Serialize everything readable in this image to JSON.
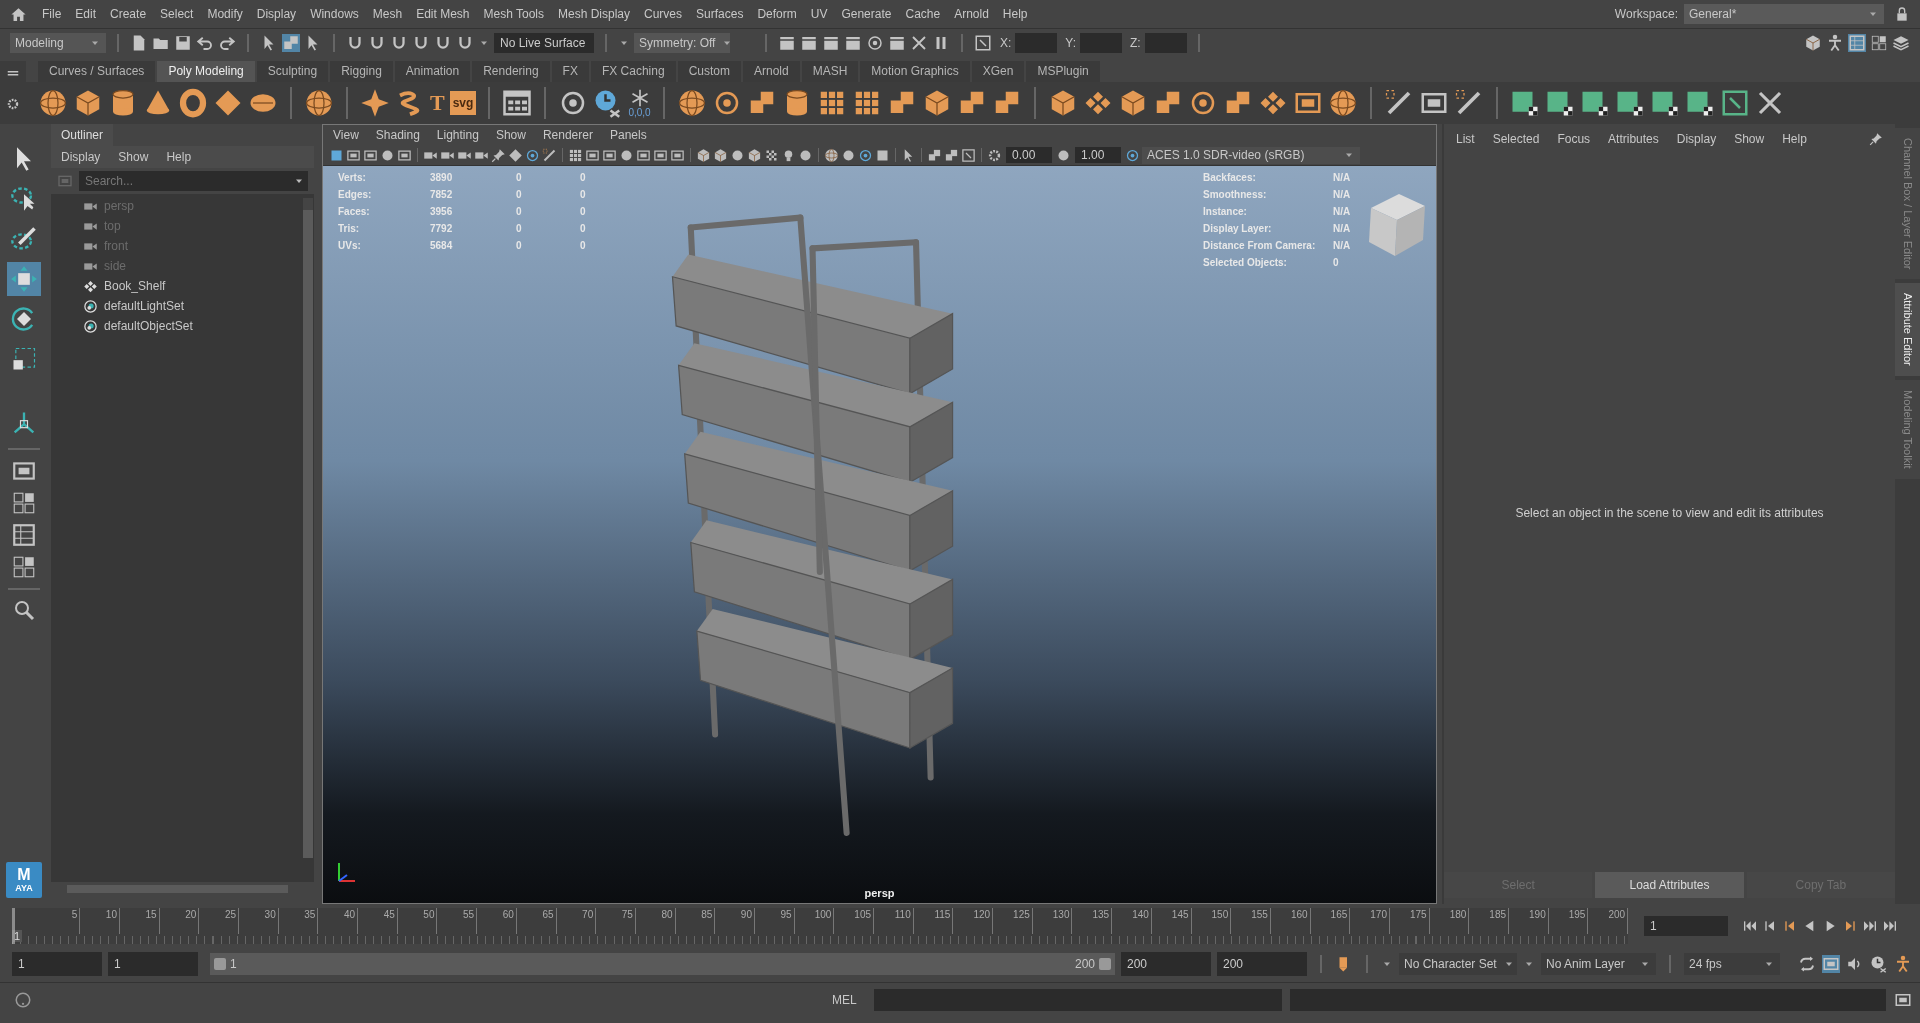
{
  "menu_bar": {
    "items": [
      "File",
      "Edit",
      "Create",
      "Select",
      "Modify",
      "Display",
      "Windows",
      "Mesh",
      "Edit Mesh",
      "Mesh Tools",
      "Mesh Display",
      "Curves",
      "Surfaces",
      "Deform",
      "UV",
      "Generate",
      "Cache",
      "Arnold",
      "Help"
    ],
    "workspace_label": "Workspace:",
    "workspace": "General*"
  },
  "status_line": {
    "mode": "Modeling",
    "live_surface": "No Live Surface",
    "symmetry": "Symmetry: Off",
    "x_label": "X:",
    "y_label": "Y:",
    "z_label": "Z:"
  },
  "shelf": {
    "tabs": [
      {
        "label": "Curves / Surfaces",
        "selected": false
      },
      {
        "label": "Poly Modeling",
        "selected": true
      },
      {
        "label": "Sculpting",
        "selected": false
      },
      {
        "label": "Rigging",
        "selected": false
      },
      {
        "label": "Animation",
        "selected": false
      },
      {
        "label": "Rendering",
        "selected": false
      },
      {
        "label": "FX",
        "selected": false
      },
      {
        "label": "FX Caching",
        "selected": false
      },
      {
        "label": "Custom",
        "selected": false
      },
      {
        "label": "Arnold",
        "selected": false
      },
      {
        "label": "MASH",
        "selected": false
      },
      {
        "label": "Motion Graphics",
        "selected": false
      },
      {
        "label": "XGen",
        "selected": false
      },
      {
        "label": "MSPlugin",
        "selected": false
      }
    ],
    "type_icon": "T",
    "svg_icon": "svg",
    "snowflake_caption": "0,0,0"
  },
  "toolbox": {
    "tools": [
      {
        "kind": "select",
        "selected": false
      },
      {
        "kind": "lasso",
        "selected": false
      },
      {
        "kind": "paint",
        "selected": false
      },
      {
        "kind": "move",
        "selected": true
      },
      {
        "kind": "rotate",
        "selected": false
      },
      {
        "kind": "scale",
        "selected": false
      },
      {
        "kind": "axes",
        "selected": false
      }
    ],
    "logo": "M",
    "logo_sub": "AYA"
  },
  "outliner": {
    "title": "Outliner",
    "menus": [
      "Display",
      "Show",
      "Help"
    ],
    "search": {
      "placeholder": "Search..."
    },
    "items": [
      {
        "label": "persp",
        "kind": "camera",
        "dimmed": true
      },
      {
        "label": "top",
        "kind": "camera",
        "dimmed": true
      },
      {
        "label": "front",
        "kind": "camera",
        "dimmed": true
      },
      {
        "label": "side",
        "kind": "camera",
        "dimmed": true
      },
      {
        "label": "Book_Shelf",
        "kind": "transform",
        "dimmed": false
      },
      {
        "label": "defaultLightSet",
        "kind": "set",
        "dimmed": false
      },
      {
        "label": "defaultObjectSet",
        "kind": "set",
        "dimmed": false
      }
    ]
  },
  "viewport": {
    "menus": [
      "View",
      "Shading",
      "Lighting",
      "Show",
      "Renderer",
      "Panels"
    ],
    "exposure": "0.00",
    "gamma": "1.00",
    "color_space": "ACES 1.0 SDR-video (sRGB)",
    "hud_left": [
      {
        "label": "Verts:",
        "values": [
          "3890",
          "0",
          "0"
        ]
      },
      {
        "label": "Edges:",
        "values": [
          "7852",
          "0",
          "0"
        ]
      },
      {
        "label": "Faces:",
        "values": [
          "3956",
          "0",
          "0"
        ]
      },
      {
        "label": "Tris:",
        "values": [
          "7792",
          "0",
          "0"
        ]
      },
      {
        "label": "UVs:",
        "values": [
          "5684",
          "0",
          "0"
        ]
      }
    ],
    "hud_right": [
      {
        "label": "Backfaces:",
        "value": "N/A"
      },
      {
        "label": "Smoothness:",
        "value": "N/A"
      },
      {
        "label": "Instance:",
        "value": "N/A"
      },
      {
        "label": "Display Layer:",
        "value": "N/A"
      },
      {
        "label": "Distance From Camera:",
        "value": "N/A"
      },
      {
        "label": "Selected Objects:",
        "value": "0"
      }
    ],
    "camera_label": "persp"
  },
  "attribute_editor": {
    "menus": [
      "List",
      "Selected",
      "Focus",
      "Attributes",
      "Display",
      "Show",
      "Help"
    ],
    "message": "Select an object in the scene to view and edit its attributes",
    "buttons": [
      {
        "label": "Select",
        "disabled": true
      },
      {
        "label": "Load Attributes",
        "disabled": false
      },
      {
        "label": "Copy Tab",
        "disabled": true
      }
    ]
  },
  "side_tabs": [
    {
      "label": "Channel Box / Layer Editor",
      "selected": false
    },
    {
      "label": "Attribute Editor",
      "selected": true
    },
    {
      "label": "Modeling Toolkit",
      "selected": false
    }
  ],
  "time_slider": {
    "current_marker": "1",
    "ticks": [
      "5",
      "10",
      "15",
      "20",
      "25",
      "30",
      "35",
      "40",
      "45",
      "50",
      "55",
      "60",
      "65",
      "70",
      "75",
      "80",
      "85",
      "90",
      "95",
      "100",
      "105",
      "110",
      "115",
      "120",
      "125",
      "130",
      "135",
      "140",
      "145",
      "150",
      "155",
      "160",
      "165",
      "170",
      "175",
      "180",
      "185",
      "190",
      "195",
      "200"
    ],
    "current_frame": "1",
    "level": 0
  },
  "range_slider": {
    "start": "1",
    "playback_start": "1",
    "range_start": "1",
    "range_end": "200",
    "playback_end": "200",
    "end": "200",
    "character_set": "No Character Set",
    "anim_layer": "No Anim Layer",
    "fps": "24 fps",
    "level": 1
  },
  "command_line": {
    "language": "MEL"
  }
}
